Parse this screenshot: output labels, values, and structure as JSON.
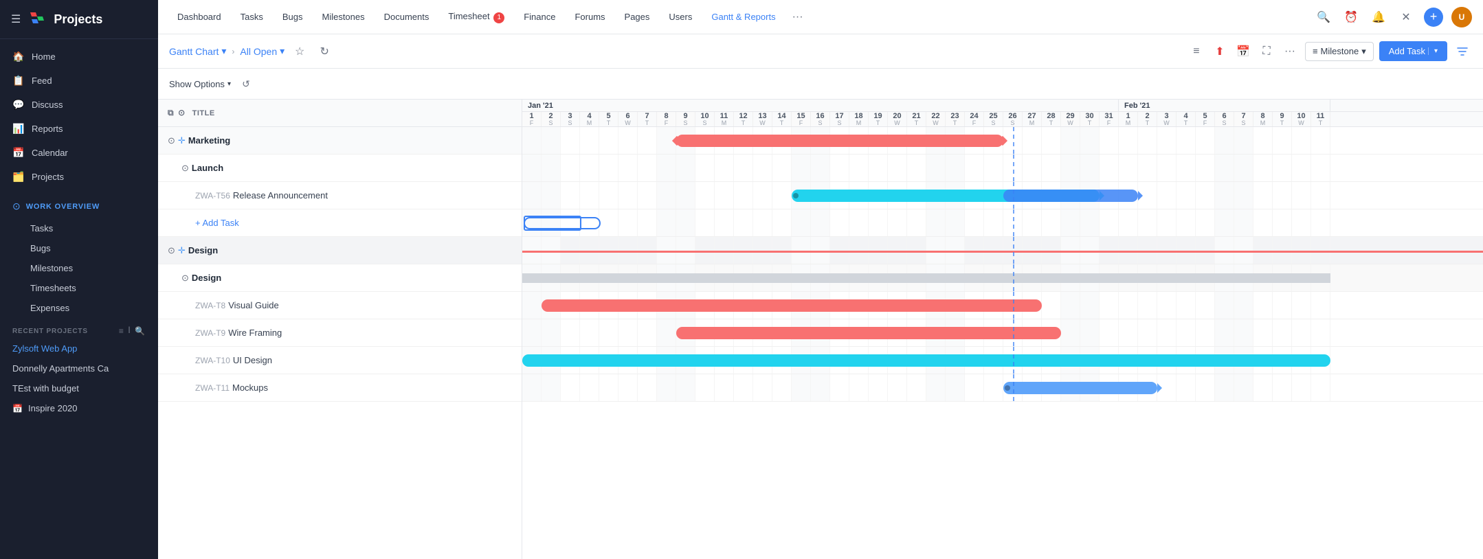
{
  "sidebar": {
    "title": "Projects",
    "nav_items": [
      {
        "id": "home",
        "label": "Home",
        "icon": "🏠"
      },
      {
        "id": "feed",
        "label": "Feed",
        "icon": "📋"
      },
      {
        "id": "discuss",
        "label": "Discuss",
        "icon": "💬"
      },
      {
        "id": "reports",
        "label": "Reports",
        "icon": "📊"
      },
      {
        "id": "calendar",
        "label": "Calendar",
        "icon": "📅"
      },
      {
        "id": "projects",
        "label": "Projects",
        "icon": "🗂️"
      }
    ],
    "work_overview": {
      "label": "WORK OVERVIEW",
      "items": [
        {
          "id": "tasks",
          "label": "Tasks"
        },
        {
          "id": "bugs",
          "label": "Bugs"
        },
        {
          "id": "milestones",
          "label": "Milestones"
        },
        {
          "id": "timesheets",
          "label": "Timesheets"
        },
        {
          "id": "expenses",
          "label": "Expenses"
        }
      ]
    },
    "recent_projects": {
      "label": "RECENT PROJECTS",
      "items": [
        {
          "id": "zylsoft",
          "label": "Zylsoft Web App",
          "active": true
        },
        {
          "id": "donnelly",
          "label": "Donnelly Apartments Ca"
        },
        {
          "id": "test-budget",
          "label": "TEst with budget"
        },
        {
          "id": "inspire",
          "label": "Inspire 2020",
          "icon": "📅"
        }
      ]
    }
  },
  "top_nav": {
    "items": [
      {
        "id": "dashboard",
        "label": "Dashboard"
      },
      {
        "id": "tasks",
        "label": "Tasks"
      },
      {
        "id": "bugs",
        "label": "Bugs"
      },
      {
        "id": "milestones",
        "label": "Milestones"
      },
      {
        "id": "documents",
        "label": "Documents"
      },
      {
        "id": "timesheet",
        "label": "Timesheet",
        "badge": "1"
      },
      {
        "id": "finance",
        "label": "Finance"
      },
      {
        "id": "forums",
        "label": "Forums"
      },
      {
        "id": "pages",
        "label": "Pages"
      },
      {
        "id": "users",
        "label": "Users"
      },
      {
        "id": "gantt",
        "label": "Gantt & Reports",
        "active": true
      }
    ],
    "more_label": "···"
  },
  "toolbar": {
    "gantt_chart_label": "Gantt Chart",
    "all_open_label": "All Open",
    "milestone_label": "Milestone",
    "add_task_label": "Add Task"
  },
  "options_bar": {
    "show_options_label": "Show Options"
  },
  "gantt": {
    "title_column_header": "TITLE",
    "months": [
      {
        "label": "Jan '21",
        "days": 31
      },
      {
        "label": "Feb '21",
        "days": 11
      }
    ],
    "days_jan": [
      1,
      2,
      3,
      4,
      5,
      6,
      7,
      8,
      9,
      10,
      11,
      12,
      13,
      14,
      15,
      16,
      17,
      18,
      19,
      20,
      21,
      22,
      23,
      24,
      25,
      26,
      27,
      28,
      29,
      30,
      31
    ],
    "days_jan_letters": [
      "F",
      "S",
      "S",
      "M",
      "T",
      "W",
      "T",
      "F",
      "S",
      "S",
      "M",
      "T",
      "W",
      "T",
      "F",
      "S",
      "S",
      "M",
      "T",
      "W",
      "T",
      "W",
      "T",
      "F",
      "S",
      "S",
      "M",
      "T",
      "W",
      "T",
      "F"
    ],
    "days_feb": [
      1,
      2,
      3,
      4,
      5,
      6,
      7,
      8,
      9,
      10,
      11
    ],
    "days_feb_letters": [
      "M",
      "T",
      "W",
      "T",
      "F",
      "S",
      "S",
      "M",
      "T",
      "W",
      "T"
    ],
    "rows": [
      {
        "id": "marketing",
        "indent": 0,
        "type": "group",
        "title": "Marketing",
        "icon": "circle-expand",
        "drag_icon": true
      },
      {
        "id": "launch",
        "indent": 1,
        "type": "subgroup",
        "title": "Launch",
        "icon": "circle-expand"
      },
      {
        "id": "zwa-t56",
        "indent": 2,
        "type": "task",
        "code": "ZWA-T56",
        "title": "Release Announcement"
      },
      {
        "id": "add-task-launch",
        "indent": 2,
        "type": "add-task"
      },
      {
        "id": "design-group",
        "indent": 0,
        "type": "group",
        "title": "Design",
        "icon": "circle-expand",
        "drag_icon": true
      },
      {
        "id": "design-sub",
        "indent": 1,
        "type": "subgroup",
        "title": "Design",
        "icon": "circle-expand"
      },
      {
        "id": "zwa-t8",
        "indent": 2,
        "type": "task",
        "code": "ZWA-T8",
        "title": "Visual Guide"
      },
      {
        "id": "zwa-t9",
        "indent": 2,
        "type": "task",
        "code": "ZWA-T9",
        "title": "Wire Framing"
      },
      {
        "id": "zwa-t10",
        "indent": 2,
        "type": "task",
        "code": "ZWA-T10",
        "title": "UI Design"
      },
      {
        "id": "zwa-t11",
        "indent": 2,
        "type": "task",
        "code": "ZWA-T11",
        "title": "Mockups"
      }
    ]
  }
}
